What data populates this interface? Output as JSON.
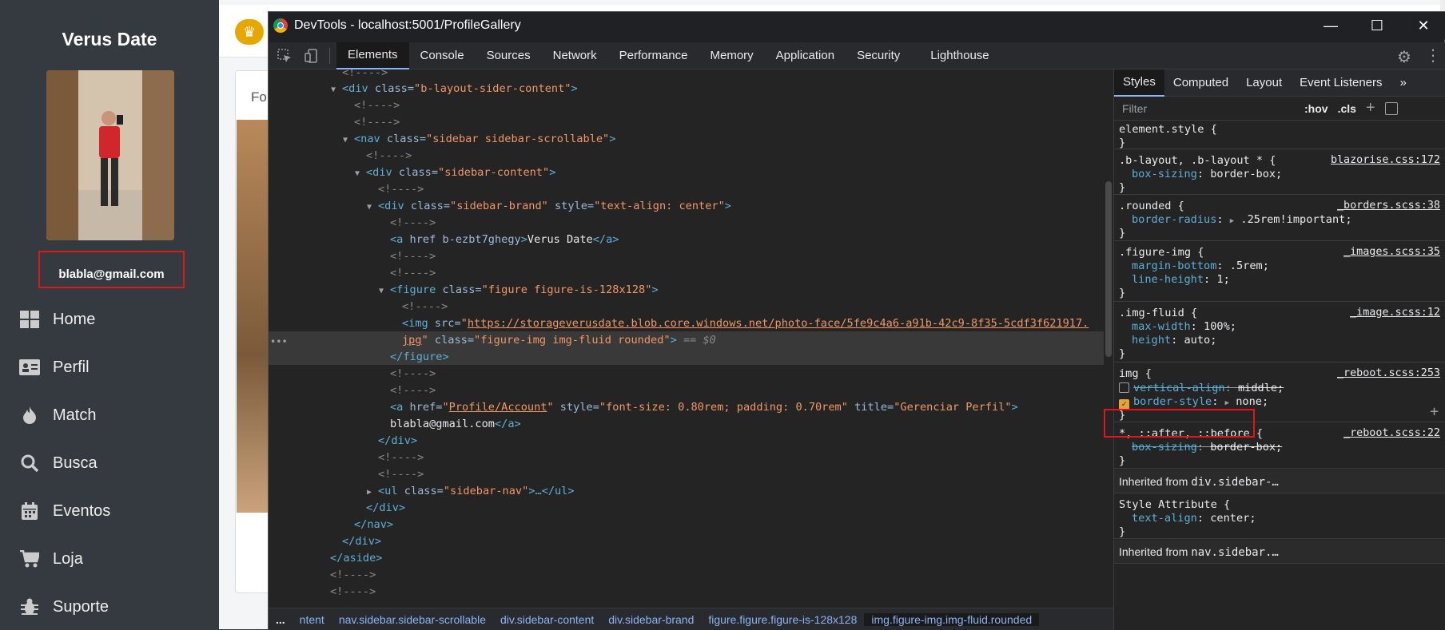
{
  "app": {
    "brand": "Verus Date",
    "email": "blabla@gmail.com",
    "nav": [
      {
        "label": "Home",
        "icon": "home-grid-icon"
      },
      {
        "label": "Perfil",
        "icon": "id-card-icon"
      },
      {
        "label": "Match",
        "icon": "fire-icon"
      },
      {
        "label": "Busca",
        "icon": "search-icon"
      },
      {
        "label": "Eventos",
        "icon": "calendar-icon"
      },
      {
        "label": "Loja",
        "icon": "cart-icon"
      },
      {
        "label": "Suporte",
        "icon": "bug-icon"
      }
    ],
    "card_label": "Fo"
  },
  "devtools": {
    "title": "DevTools - localhost:5001/ProfileGallery",
    "tabs": [
      "Elements",
      "Console",
      "Sources",
      "Network",
      "Performance",
      "Memory",
      "Application",
      "Security",
      "Lighthouse"
    ],
    "active_tab": "Elements",
    "dom": {
      "l0": "<!---->",
      "l1_tag": "<div",
      "l1_attr": " class=",
      "l1_val": "\"b-layout-sider-content\"",
      "l1_end": ">",
      "l2": "<!---->",
      "l3": "<!---->",
      "l4_tag": "<nav",
      "l4_attr": " class=",
      "l4_val": "\"sidebar sidebar-scrollable\"",
      "l4_end": ">",
      "l5": "<!---->",
      "l6_tag": "<div",
      "l6_attr": " class=",
      "l6_val": "\"sidebar-content\"",
      "l6_end": ">",
      "l7": "<!---->",
      "l8_tag": "<div",
      "l8_attr1": " class=",
      "l8_val1": "\"sidebar-brand\"",
      "l8_attr2": " style=",
      "l8_val2": "\"text-align: center\"",
      "l8_end": ">",
      "l9": "<!---->",
      "l10_tag": "<a",
      "l10_attr": " href b-ezbt7ghegy",
      "l10_end": ">",
      "l10_text": "Verus Date",
      "l10_close": "</a>",
      "l11": "<!---->",
      "l12": "<!---->",
      "l13_tag": "<figure",
      "l13_attr": " class=",
      "l13_val": "\"figure figure-is-128x128\"",
      "l13_end": ">",
      "l14": "<!---->",
      "l15_tag": "<img",
      "l15_attr": " src=",
      "l15_q": "\"",
      "l15_url": "https://storageverusdate.blob.core.windows.net/photo-face/5fe9c4a6-a91b-42c9-8f35-5cdf3f621917.",
      "l16_url": "jpg",
      "l16_rest_q": "\"",
      "l16_attr": " class=",
      "l16_val": "\"figure-img img-fluid rounded\"",
      "l16_end": ">",
      "l16_eq": " == $0",
      "l17": "</figure>",
      "l18": "<!---->",
      "l19": "<!---->",
      "l20_tag": "<a",
      "l20_attr1": " href=",
      "l20_q1": "\"",
      "l20_url": "Profile/Account",
      "l20_q2": "\"",
      "l20_attr2": " style=",
      "l20_val2": "\"font-size: 0.80rem; padding: 0.70rem\"",
      "l20_attr3": " title=",
      "l20_val3": "\"Gerenciar Perfil\"",
      "l20_end": ">",
      "l21_text": "blabla@gmail.com",
      "l21_close": "</a>",
      "l22": "</div>",
      "l23": "<!---->",
      "l24": "<!---->",
      "l25_tag": "<ul",
      "l25_attr": " class=",
      "l25_val": "\"sidebar-nav\"",
      "l25_end": ">…</ul>",
      "l26": "</div>",
      "l27": "</nav>",
      "l28": "</div>",
      "l29": "</aside>",
      "l30": "<!---->",
      "l31": "<!---->"
    },
    "breadcrumbs": [
      "...",
      "ntent",
      "nav.sidebar.sidebar-scrollable",
      "div.sidebar-content",
      "div.sidebar-brand",
      "figure.figure.figure-is-128x128",
      "img.figure-img.img-fluid.rounded"
    ],
    "styles": {
      "tabs": [
        "Styles",
        "Computed",
        "Layout",
        "Event Listeners",
        "»"
      ],
      "active_tab": "Styles",
      "filter_placeholder": "Filter",
      "hov": ":hov",
      "cls": ".cls",
      "plus": "+",
      "rules": {
        "r0_sel": "element.style {",
        "r0_close": "}",
        "r1_sel": ".b-layout, .b-layout * {",
        "r1_src": "blazorise.css:172",
        "r1_p1": "box-sizing",
        "r1_v1": "border-box;",
        "r1_close": "}",
        "r2_sel": ".rounded {",
        "r2_src": "_borders.scss:38",
        "r2_p1": "border-radius",
        "r2_v1": ".25rem!important;",
        "r2_close": "}",
        "r3_sel": ".figure-img {",
        "r3_src": "_images.scss:35",
        "r3_p1": "margin-bottom",
        "r3_v1": ".5rem;",
        "r3_p2": "line-height",
        "r3_v2": "1;",
        "r3_close": "}",
        "r4_sel": ".img-fluid {",
        "r4_src": "_image.scss:12",
        "r4_p1": "max-width",
        "r4_v1": "100%;",
        "r4_p2": "height",
        "r4_v2": "auto;",
        "r4_close": "}",
        "r5_sel": "img {",
        "r5_src": "_reboot.scss:253",
        "r5_p1": "vertical-align",
        "r5_v1": "middle;",
        "r5_p2": "border-style",
        "r5_v2": "none;",
        "r5_close": "}",
        "r6_sel": "*, ::after, ::before {",
        "r6_src": "_reboot.scss:22",
        "r6_p1": "box-sizing",
        "r6_v1": "border-box;",
        "r6_close": "}",
        "inh1_label": "Inherited from",
        "inh1_val": "div.sidebar-…",
        "r7_sel": "Style Attribute {",
        "r7_p1": "text-align",
        "r7_v1": "center;",
        "r7_close": "}",
        "inh2_label": "Inherited from",
        "inh2_val": "nav.sidebar.…"
      }
    }
  },
  "colors": {
    "sidebar_bg": "#343a40",
    "highlight_red": "#e0161a",
    "devtools_bg": "#242424",
    "tag_blue": "#5db0d7",
    "attr_value_orange": "#f29766",
    "link_blue": "#8ab4f8"
  }
}
